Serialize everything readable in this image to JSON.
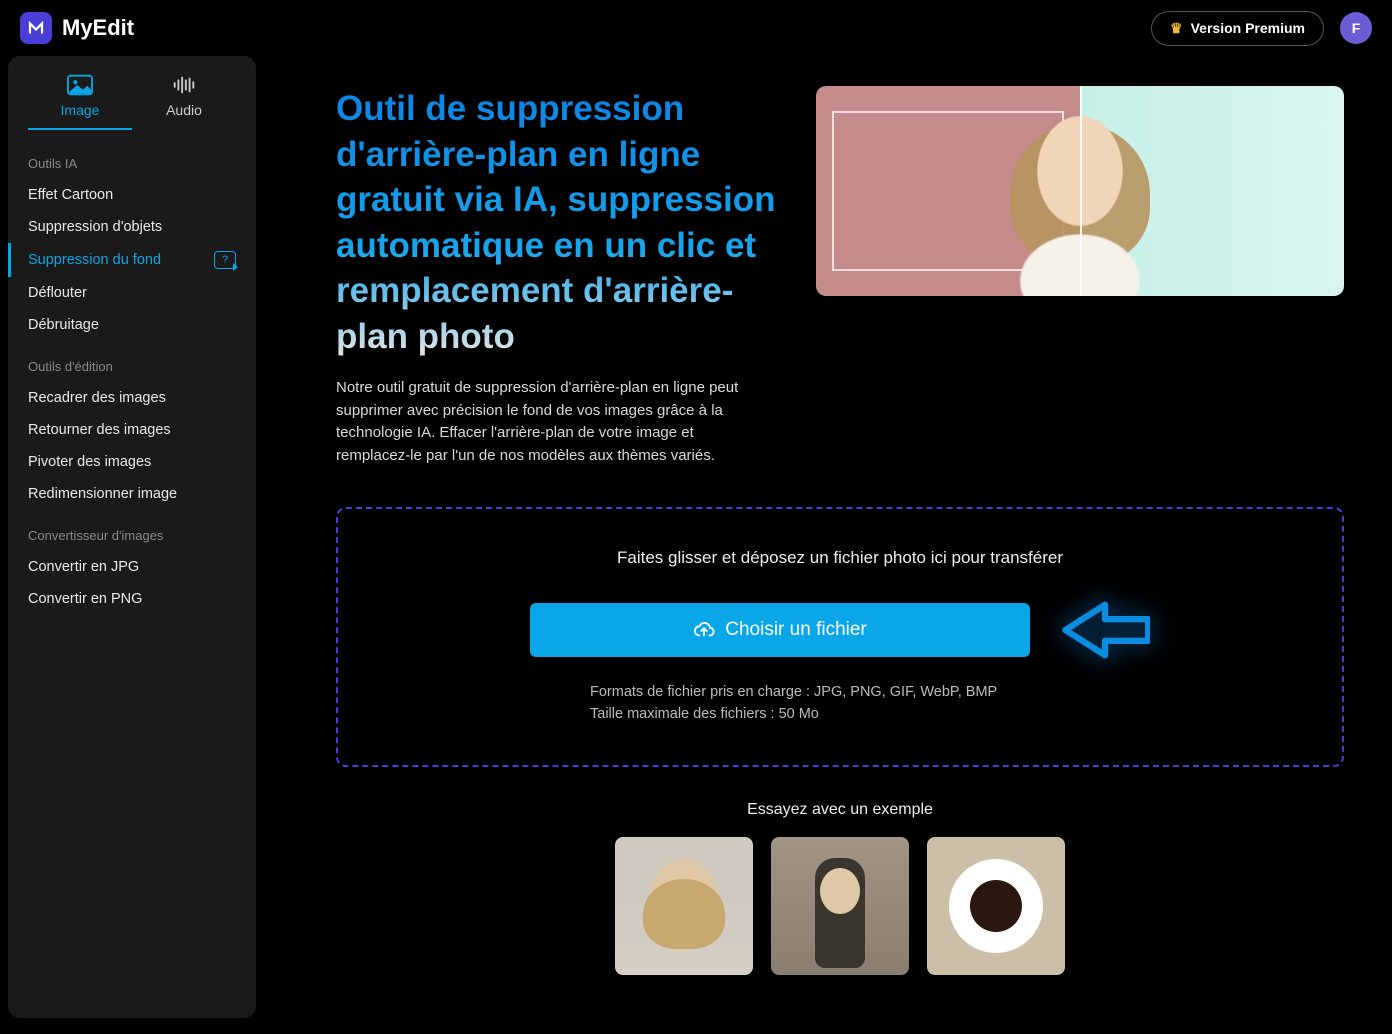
{
  "brand": "MyEdit",
  "topbar": {
    "premium_label": "Version Premium",
    "avatar_letter": "F"
  },
  "tabs": {
    "image": "Image",
    "audio": "Audio",
    "active": "image"
  },
  "sidebar": {
    "sections": [
      {
        "title": "Outils IA",
        "items": [
          {
            "label": "Effet Cartoon",
            "active": false
          },
          {
            "label": "Suppression d'objets",
            "active": false
          },
          {
            "label": "Suppression du fond",
            "active": true,
            "help": true
          },
          {
            "label": "Déflouter",
            "active": false
          },
          {
            "label": "Débruitage",
            "active": false
          }
        ]
      },
      {
        "title": "Outils d'édition",
        "items": [
          {
            "label": "Recadrer des images"
          },
          {
            "label": "Retourner des images"
          },
          {
            "label": "Pivoter des images"
          },
          {
            "label": "Redimensionner image"
          }
        ]
      },
      {
        "title": "Convertisseur d'images",
        "items": [
          {
            "label": "Convertir en JPG"
          },
          {
            "label": "Convertir en PNG"
          }
        ]
      }
    ]
  },
  "hero": {
    "title": "Outil de suppression d'arrière-plan en ligne gratuit via IA, suppression automatique en un clic et remplacement d'arrière-plan photo",
    "description": "Notre outil gratuit de suppression d'arrière-plan en ligne peut supprimer avec précision le fond de vos images grâce à la technologie IA. Effacer l'arrière-plan de votre image et remplacez-le par l'un de nos modèles aux thèmes variés."
  },
  "dropzone": {
    "instruction": "Faites glisser et déposez un fichier photo ici pour transférer",
    "button_label": "Choisir un fichier",
    "formats_label": "Formats de fichier pris en charge : JPG, PNG, GIF, WebP, BMP",
    "maxsize_label": "Taille maximale des fichiers : 50 Mo"
  },
  "examples": {
    "title": "Essayez avec un exemple",
    "thumbs": [
      "woman-portrait",
      "woman-street",
      "coffee-cup"
    ]
  },
  "colors": {
    "accent": "#09a6e8",
    "dropzone_border": "#4a3ed9"
  }
}
